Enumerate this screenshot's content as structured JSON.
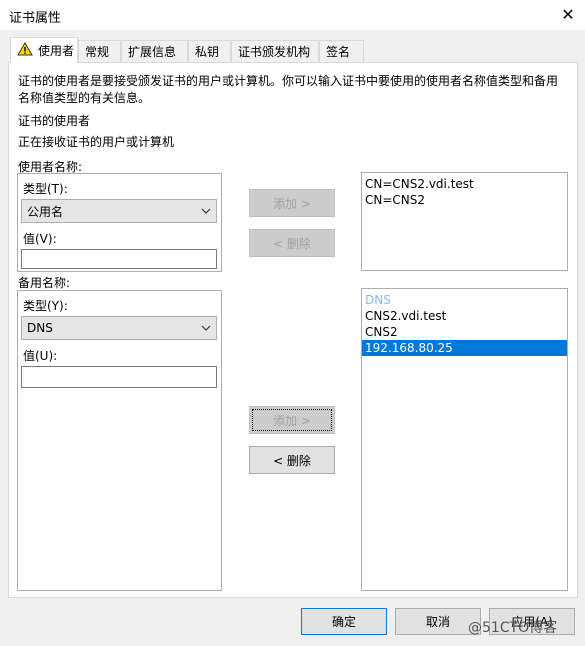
{
  "window": {
    "title": "证书属性",
    "close_glyph": "✕"
  },
  "tabs": [
    {
      "label": "使用者",
      "icon": "warning-icon",
      "active": true
    },
    {
      "label": "常规"
    },
    {
      "label": "扩展信息"
    },
    {
      "label": "私钥"
    },
    {
      "label": "证书颁发机构"
    },
    {
      "label": "签名"
    }
  ],
  "description": {
    "line1": "证书的使用者是要接受颁发证书的用户或计算机。你可以输入证书中要使用的使用者名称值类型和备用",
    "line2": "名称值类型的有关信息。"
  },
  "subject": {
    "heading": "证书的使用者",
    "text": "正在接收证书的用户或计算机"
  },
  "subject_name": {
    "group_label": "使用者名称:",
    "type_label": "类型(T):",
    "type_value": "公用名",
    "value_label": "值(V):",
    "value": "",
    "add_button": "添加 >",
    "remove_button": "< 删除",
    "list": [
      "CN=CNS2.vdi.test",
      "CN=CNS2"
    ]
  },
  "alt_name": {
    "group_label": "备用名称:",
    "type_label": "类型(Y):",
    "type_value": "DNS",
    "value_label": "值(U):",
    "value": "",
    "add_button": "添加 >",
    "remove_button": "< 删除",
    "list_heading": "DNS",
    "list": [
      "CNS2.vdi.test",
      "CNS2",
      "192.168.80.25"
    ],
    "selected_index": 2
  },
  "footer": {
    "ok": "确定",
    "cancel": "取消",
    "apply": "应用(A)"
  },
  "watermark": "@51CTO博客",
  "colors": {
    "selection": "#0078d7",
    "disabled_text": "#a0a0a0",
    "panel": "#ffffff",
    "window_bg": "#f0f0f0"
  }
}
